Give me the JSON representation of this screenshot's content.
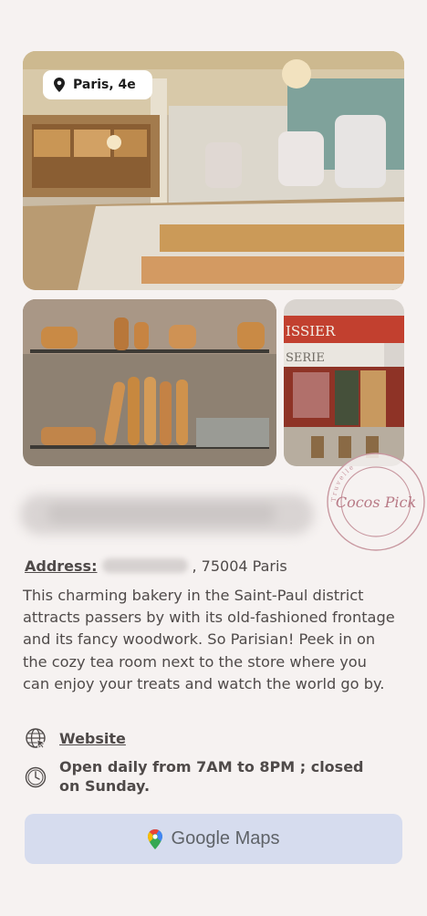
{
  "location_badge": {
    "label": "Paris, 4e",
    "icon": "map-pin-icon"
  },
  "stamp": {
    "text": "Cocos Pick",
    "ring_text": "Truvelle"
  },
  "address": {
    "label": "Address:",
    "value": ", 75004 Paris"
  },
  "description": "This charming bakery in the Saint-Paul district attracts passers by with its old-fashioned frontage and its fancy woodwork. So Parisian! Peek in on the cozy tea room next to the store where you can enjoy your treats and watch the world go by.",
  "website": {
    "label": "Website",
    "icon": "globe-icon"
  },
  "hours": {
    "text": "Open daily from 7AM to 8PM ; closed on Sunday.",
    "icon": "clock-icon"
  },
  "maps_button": {
    "label_google": "Google",
    "label_maps": "Maps",
    "icon": "google-maps-pin-icon"
  },
  "photo_signs": {
    "front_sign": "ISSIER",
    "front_sign_2": "SERIE"
  },
  "colors": {
    "background": "#f6f2f1",
    "text": "#4f4a49",
    "button": "#d6dcee",
    "stamp": "#b87a86"
  }
}
